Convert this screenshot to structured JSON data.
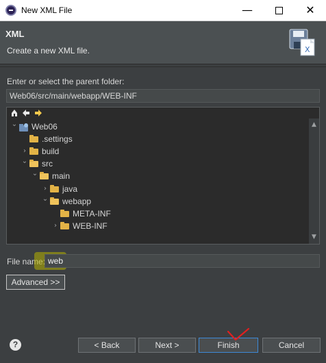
{
  "window": {
    "title": "New XML File",
    "minimize_glyph": "—",
    "close_glyph": "✕"
  },
  "banner": {
    "title": "XML",
    "description": "Create a new XML file."
  },
  "folder": {
    "label": "Enter or select the parent folder:",
    "value": "Web06/src/main/webapp/WEB-INF"
  },
  "tree": {
    "toolbar": [
      "home-icon",
      "back-arrow-icon",
      "forward-arrow-icon"
    ],
    "rows": [
      {
        "label": "Web06",
        "depth": 0,
        "expanded": true,
        "type": "project"
      },
      {
        "label": ".settings",
        "depth": 1,
        "expanded": null,
        "type": "folder"
      },
      {
        "label": "build",
        "depth": 1,
        "expanded": false,
        "type": "folder"
      },
      {
        "label": "src",
        "depth": 1,
        "expanded": true,
        "type": "folder"
      },
      {
        "label": "main",
        "depth": 2,
        "expanded": true,
        "type": "folder"
      },
      {
        "label": "java",
        "depth": 3,
        "expanded": false,
        "type": "folder"
      },
      {
        "label": "webapp",
        "depth": 3,
        "expanded": true,
        "type": "folder"
      },
      {
        "label": "META-INF",
        "depth": 4,
        "expanded": null,
        "type": "folder"
      },
      {
        "label": "WEB-INF",
        "depth": 4,
        "expanded": false,
        "type": "folder"
      }
    ]
  },
  "filename": {
    "label": "File name:",
    "value": "web"
  },
  "buttons": {
    "advanced": "Advanced >>",
    "back": "< Back",
    "next": "Next >",
    "finish": "Finish",
    "cancel": "Cancel",
    "help": "?"
  },
  "colors": {
    "accent": "#3d8ad8",
    "highlight": "#b7b300",
    "annotation": "#e02020"
  }
}
